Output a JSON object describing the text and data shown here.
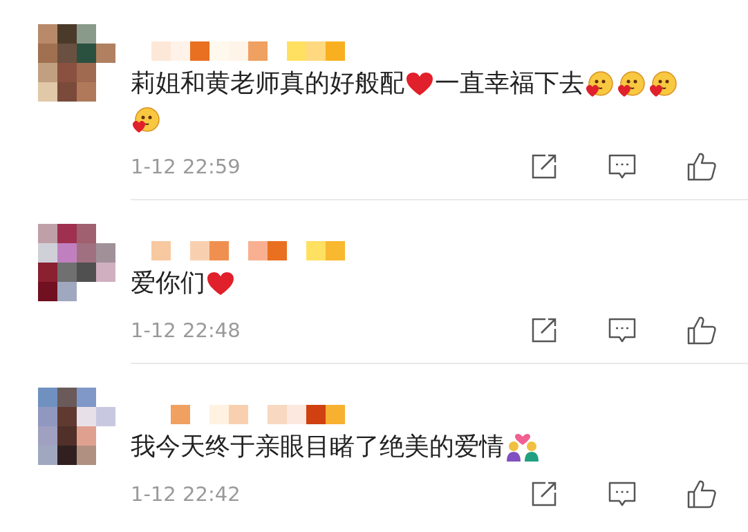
{
  "comments": [
    {
      "content": [
        {
          "kind": "text",
          "text": "莉姐和黄老师真的好般配"
        },
        {
          "kind": "heart"
        },
        {
          "kind": "text",
          "text": "一直幸福下去"
        },
        {
          "kind": "kiss-face"
        },
        {
          "kind": "kiss-face"
        },
        {
          "kind": "kiss-face"
        },
        {
          "kind": "kiss-face"
        }
      ],
      "time": "1-12 22:59"
    },
    {
      "content": [
        {
          "kind": "text",
          "text": "爱你们"
        },
        {
          "kind": "heart"
        }
      ],
      "time": "1-12 22:48"
    },
    {
      "content": [
        {
          "kind": "text",
          "text": "我今天终于亲眼目睹了绝美的爱情"
        },
        {
          "kind": "couple"
        }
      ],
      "time": "1-12 22:42"
    }
  ]
}
